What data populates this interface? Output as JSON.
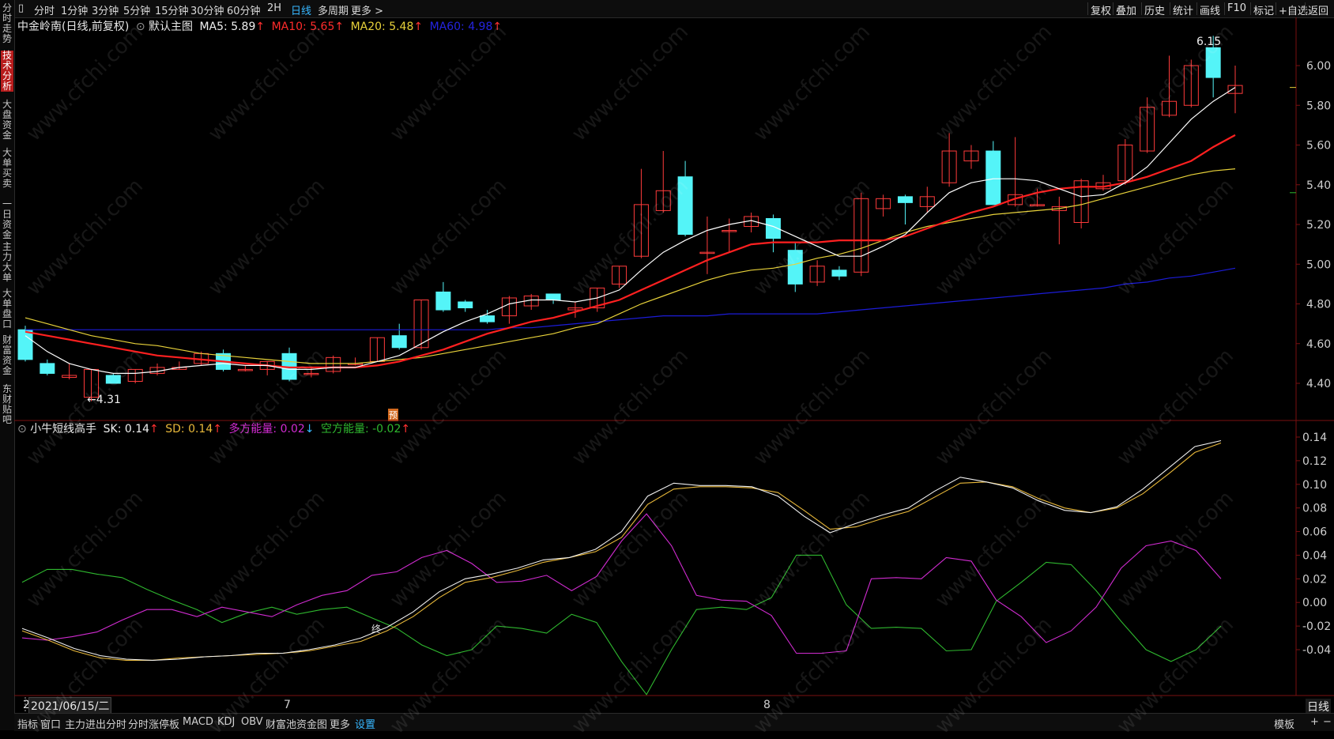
{
  "toolbar": {
    "left_items": [
      {
        "label": "分时",
        "active": false
      },
      {
        "label": "1分钟",
        "active": false
      },
      {
        "label": "3分钟",
        "active": false
      },
      {
        "label": "5分钟",
        "active": false
      },
      {
        "label": "15分钟",
        "active": false
      },
      {
        "label": "30分钟",
        "active": false
      },
      {
        "label": "60分钟",
        "active": false
      },
      {
        "label": "2H",
        "active": false
      },
      {
        "label": "日线",
        "active": true
      },
      {
        "label": "多周期",
        "active": false
      },
      {
        "label": "更多 >",
        "active": false
      }
    ],
    "right_items": [
      "复权",
      "叠加",
      "历史",
      "统计",
      "画线",
      "F10",
      "标记",
      "+自选",
      "返回"
    ]
  },
  "sidebar": {
    "items": [
      {
        "label": "分时走势",
        "active": false
      },
      {
        "label": "技术分析",
        "active": true
      },
      {
        "label": "大盘资金",
        "active": false
      },
      {
        "label": "大单买卖",
        "active": false
      },
      {
        "label": "一日资金",
        "active": false
      },
      {
        "label": "主力大单",
        "active": false
      },
      {
        "label": "大单盘口",
        "active": false
      },
      {
        "label": "财富资金",
        "active": false
      },
      {
        "label": "东财贴吧",
        "active": false
      }
    ]
  },
  "main_legend": {
    "stock": "中金岭南(日线,前复权)",
    "mode": "默认主图",
    "ma5": "MA5: 5.89",
    "ma10": "MA10: 5.65",
    "ma20": "MA20: 5.48",
    "ma60": "MA60: 4.98",
    "arrow_up": "↑"
  },
  "sub_legend": {
    "name": "小牛短线高手",
    "sk": "SK: 0.14",
    "sd": "SD: 0.14",
    "duo": "多方能量: 0.02",
    "kong": "空方能量: -0.02",
    "arrow_up": "↑",
    "arrow_down": "↓"
  },
  "annotations": {
    "high": "6.15",
    "low": "←4.31",
    "buy_tag": "预",
    "label_end": "终"
  },
  "x_axis": {
    "date": "2021/06/15/二",
    "lead": "2",
    "month7": "7",
    "month8": "8",
    "period": "日线"
  },
  "bottombar": {
    "items": [
      {
        "label": "指标",
        "active": false
      },
      {
        "label": "窗口",
        "active": false
      },
      {
        "label": "主力进出分时",
        "active": false
      },
      {
        "label": "分时涨停板",
        "active": false
      },
      {
        "label": "MACD",
        "active": false
      },
      {
        "label": "KDJ",
        "active": false
      },
      {
        "label": "OBV",
        "active": false
      },
      {
        "label": "财富池资金图",
        "active": false
      },
      {
        "label": "更多",
        "active": false
      },
      {
        "label": "设置",
        "active": true
      }
    ],
    "right": [
      "模板",
      "+",
      "−"
    ]
  },
  "watermark": "www.cfchi.com",
  "colors": {
    "up": "#ff3b3b",
    "down": "#54f4f8",
    "ma5": "#ffffff",
    "ma10": "#ff2020",
    "ma20": "#e8d23a",
    "ma60": "#1c1cd8",
    "sk": "#f0f0f0",
    "sd": "#e8b83a",
    "duo": "#d02bd0",
    "kong": "#2fb82f"
  },
  "chart_data": [
    {
      "type": "candlestick",
      "title": "中金岭南(日线,前复权)",
      "yticks": [
        "6.00",
        "5.80",
        "5.60",
        "5.40",
        "5.20",
        "5.00",
        "4.80",
        "4.60",
        "4.40"
      ],
      "ylim": [
        4.29,
        6.22
      ],
      "candles": [
        {
          "o": 4.67,
          "h": 4.69,
          "l": 4.51,
          "c": 4.52
        },
        {
          "o": 4.5,
          "h": 4.52,
          "l": 4.44,
          "c": 4.45
        },
        {
          "o": 4.43,
          "h": 4.5,
          "l": 4.42,
          "c": 4.44
        },
        {
          "o": 4.33,
          "h": 4.47,
          "l": 4.31,
          "c": 4.47
        },
        {
          "o": 4.44,
          "h": 4.45,
          "l": 4.4,
          "c": 4.4
        },
        {
          "o": 4.41,
          "h": 4.47,
          "l": 4.4,
          "c": 4.47
        },
        {
          "o": 4.45,
          "h": 4.5,
          "l": 4.44,
          "c": 4.48
        },
        {
          "o": 4.47,
          "h": 4.51,
          "l": 4.47,
          "c": 4.48
        },
        {
          "o": 4.5,
          "h": 4.56,
          "l": 4.49,
          "c": 4.55
        },
        {
          "o": 4.55,
          "h": 4.57,
          "l": 4.46,
          "c": 4.47
        },
        {
          "o": 4.47,
          "h": 4.49,
          "l": 4.46,
          "c": 4.47
        },
        {
          "o": 4.47,
          "h": 4.51,
          "l": 4.44,
          "c": 4.51
        },
        {
          "o": 4.55,
          "h": 4.58,
          "l": 4.41,
          "c": 4.42
        },
        {
          "o": 4.45,
          "h": 4.48,
          "l": 4.43,
          "c": 4.45
        },
        {
          "o": 4.46,
          "h": 4.54,
          "l": 4.45,
          "c": 4.53
        },
        {
          "o": 4.5,
          "h": 4.53,
          "l": 4.49,
          "c": 4.5
        },
        {
          "o": 4.51,
          "h": 4.63,
          "l": 4.51,
          "c": 4.63
        },
        {
          "o": 4.64,
          "h": 4.7,
          "l": 4.57,
          "c": 4.58
        },
        {
          "o": 4.58,
          "h": 4.82,
          "l": 4.57,
          "c": 4.82
        },
        {
          "o": 4.86,
          "h": 4.91,
          "l": 4.76,
          "c": 4.77
        },
        {
          "o": 4.81,
          "h": 4.82,
          "l": 4.76,
          "c": 4.78
        },
        {
          "o": 4.74,
          "h": 4.77,
          "l": 4.7,
          "c": 4.71
        },
        {
          "o": 4.74,
          "h": 4.84,
          "l": 4.7,
          "c": 4.83
        },
        {
          "o": 4.79,
          "h": 4.85,
          "l": 4.77,
          "c": 4.84
        },
        {
          "o": 4.85,
          "h": 4.85,
          "l": 4.8,
          "c": 4.82
        },
        {
          "o": 4.77,
          "h": 4.81,
          "l": 4.73,
          "c": 4.78
        },
        {
          "o": 4.78,
          "h": 4.88,
          "l": 4.76,
          "c": 4.88
        },
        {
          "o": 4.9,
          "h": 4.99,
          "l": 4.88,
          "c": 4.99
        },
        {
          "o": 5.04,
          "h": 5.48,
          "l": 5.03,
          "c": 5.3
        },
        {
          "o": 5.27,
          "h": 5.57,
          "l": 5.26,
          "c": 5.37
        },
        {
          "o": 5.44,
          "h": 5.52,
          "l": 5.14,
          "c": 5.15
        },
        {
          "o": 5.06,
          "h": 5.24,
          "l": 4.95,
          "c": 5.06
        },
        {
          "o": 5.17,
          "h": 5.23,
          "l": 5.06,
          "c": 5.17
        },
        {
          "o": 5.19,
          "h": 5.26,
          "l": 5.16,
          "c": 5.24
        },
        {
          "o": 5.23,
          "h": 5.25,
          "l": 5.06,
          "c": 5.13
        },
        {
          "o": 5.07,
          "h": 5.11,
          "l": 4.86,
          "c": 4.9
        },
        {
          "o": 4.91,
          "h": 5.02,
          "l": 4.89,
          "c": 4.99
        },
        {
          "o": 4.97,
          "h": 4.99,
          "l": 4.92,
          "c": 4.94
        },
        {
          "o": 4.96,
          "h": 5.36,
          "l": 4.94,
          "c": 5.33
        },
        {
          "o": 5.28,
          "h": 5.35,
          "l": 5.24,
          "c": 5.33
        },
        {
          "o": 5.34,
          "h": 5.35,
          "l": 5.2,
          "c": 5.31
        },
        {
          "o": 5.29,
          "h": 5.39,
          "l": 5.26,
          "c": 5.34
        },
        {
          "o": 5.41,
          "h": 5.66,
          "l": 5.39,
          "c": 5.57
        },
        {
          "o": 5.52,
          "h": 5.6,
          "l": 5.48,
          "c": 5.57
        },
        {
          "o": 5.57,
          "h": 5.62,
          "l": 5.3,
          "c": 5.3
        },
        {
          "o": 5.3,
          "h": 5.64,
          "l": 5.29,
          "c": 5.35
        },
        {
          "o": 5.3,
          "h": 5.38,
          "l": 5.29,
          "c": 5.3
        },
        {
          "o": 5.27,
          "h": 5.34,
          "l": 5.1,
          "c": 5.29
        },
        {
          "o": 5.21,
          "h": 5.43,
          "l": 5.18,
          "c": 5.42
        },
        {
          "o": 5.38,
          "h": 5.45,
          "l": 5.37,
          "c": 5.41
        },
        {
          "o": 5.42,
          "h": 5.63,
          "l": 5.4,
          "c": 5.6
        },
        {
          "o": 5.57,
          "h": 5.84,
          "l": 5.56,
          "c": 5.79
        },
        {
          "o": 5.75,
          "h": 6.05,
          "l": 5.74,
          "c": 5.82
        },
        {
          "o": 5.8,
          "h": 6.03,
          "l": 5.79,
          "c": 6.0
        },
        {
          "o": 6.09,
          "h": 6.15,
          "l": 5.84,
          "c": 5.94
        },
        {
          "o": 5.86,
          "h": 6.0,
          "l": 5.76,
          "c": 5.9
        }
      ],
      "ma5": [
        4.64,
        4.56,
        4.5,
        4.47,
        4.45,
        4.45,
        4.46,
        4.48,
        4.49,
        4.5,
        4.49,
        4.49,
        4.47,
        4.47,
        4.48,
        4.48,
        4.51,
        4.54,
        4.6,
        4.66,
        4.71,
        4.75,
        4.8,
        4.82,
        4.82,
        4.81,
        4.83,
        4.87,
        4.97,
        5.06,
        5.12,
        5.17,
        5.2,
        5.22,
        5.19,
        5.14,
        5.09,
        5.04,
        5.04,
        5.09,
        5.15,
        5.26,
        5.36,
        5.41,
        5.43,
        5.43,
        5.42,
        5.38,
        5.34,
        5.35,
        5.41,
        5.49,
        5.61,
        5.73,
        5.82,
        5.89
      ],
      "ma10": [
        4.66,
        4.64,
        4.62,
        4.6,
        4.58,
        4.56,
        4.54,
        4.53,
        4.52,
        4.51,
        4.5,
        4.49,
        4.48,
        4.48,
        4.48,
        4.48,
        4.49,
        4.51,
        4.54,
        4.57,
        4.61,
        4.65,
        4.68,
        4.71,
        4.73,
        4.76,
        4.79,
        4.82,
        4.87,
        4.92,
        4.97,
        5.02,
        5.06,
        5.1,
        5.11,
        5.11,
        5.11,
        5.12,
        5.12,
        5.12,
        5.14,
        5.18,
        5.22,
        5.26,
        5.29,
        5.33,
        5.36,
        5.38,
        5.39,
        5.39,
        5.41,
        5.44,
        5.48,
        5.52,
        5.59,
        5.65
      ],
      "ma20": [
        4.73,
        4.7,
        4.67,
        4.64,
        4.62,
        4.6,
        4.59,
        4.57,
        4.55,
        4.54,
        4.53,
        4.52,
        4.51,
        4.5,
        4.5,
        4.5,
        4.51,
        4.52,
        4.53,
        4.55,
        4.57,
        4.59,
        4.61,
        4.63,
        4.65,
        4.68,
        4.7,
        4.75,
        4.8,
        4.84,
        4.88,
        4.92,
        4.95,
        4.97,
        4.98,
        5.0,
        5.03,
        5.05,
        5.08,
        5.12,
        5.16,
        5.19,
        5.21,
        5.23,
        5.25,
        5.26,
        5.27,
        5.28,
        5.3,
        5.33,
        5.36,
        5.39,
        5.42,
        5.45,
        5.47,
        5.48
      ],
      "ma60": [
        4.67,
        4.67,
        4.67,
        4.67,
        4.67,
        4.67,
        4.67,
        4.67,
        4.67,
        4.67,
        4.67,
        4.67,
        4.67,
        4.67,
        4.67,
        4.67,
        4.67,
        4.67,
        4.67,
        4.67,
        4.67,
        4.67,
        4.68,
        4.68,
        4.69,
        4.7,
        4.71,
        4.72,
        4.73,
        4.74,
        4.74,
        4.74,
        4.75,
        4.75,
        4.75,
        4.75,
        4.75,
        4.76,
        4.77,
        4.78,
        4.79,
        4.8,
        4.81,
        4.82,
        4.83,
        4.84,
        4.85,
        4.86,
        4.87,
        4.88,
        4.9,
        4.91,
        4.93,
        4.94,
        4.96,
        4.98
      ]
    },
    {
      "type": "line",
      "title": "小牛短线高手",
      "yticks": [
        "0.14",
        "0.12",
        "0.10",
        "0.08",
        "0.06",
        "0.04",
        "0.02",
        "0.00",
        "-0.02",
        "-0.04"
      ],
      "ylim": [
        -0.08,
        0.15
      ],
      "series": [
        {
          "name": "SK",
          "values": [
            -0.022,
            -0.03,
            -0.039,
            -0.045,
            -0.048,
            -0.049,
            -0.048,
            -0.046,
            -0.045,
            -0.043,
            -0.043,
            -0.04,
            -0.036,
            -0.03,
            -0.021,
            -0.008,
            0.009,
            0.02,
            0.024,
            0.029,
            0.036,
            0.038,
            0.045,
            0.06,
            0.09,
            0.101,
            0.099,
            0.099,
            0.098,
            0.09,
            0.073,
            0.059,
            0.067,
            0.074,
            0.08,
            0.094,
            0.106,
            0.102,
            0.097,
            0.086,
            0.078,
            0.076,
            0.081,
            0.096,
            0.114,
            0.132,
            0.137
          ]
        },
        {
          "name": "SD",
          "values": [
            -0.024,
            -0.032,
            -0.041,
            -0.047,
            -0.049,
            -0.049,
            -0.047,
            -0.046,
            -0.045,
            -0.044,
            -0.043,
            -0.041,
            -0.037,
            -0.033,
            -0.024,
            -0.012,
            0.004,
            0.017,
            0.021,
            0.027,
            0.034,
            0.038,
            0.043,
            0.055,
            0.083,
            0.096,
            0.098,
            0.098,
            0.097,
            0.093,
            0.078,
            0.062,
            0.064,
            0.071,
            0.077,
            0.089,
            0.101,
            0.102,
            0.098,
            0.088,
            0.08,
            0.076,
            0.08,
            0.092,
            0.109,
            0.127,
            0.135
          ]
        },
        {
          "name": "多方能量",
          "values": [
            -0.03,
            -0.032,
            -0.029,
            -0.025,
            -0.015,
            -0.006,
            -0.006,
            -0.012,
            -0.004,
            -0.008,
            -0.012,
            -0.002,
            0.006,
            0.01,
            0.023,
            0.026,
            0.038,
            0.044,
            0.033,
            0.017,
            0.018,
            0.023,
            0.01,
            0.022,
            0.052,
            0.075,
            0.048,
            0.006,
            0.002,
            0.001,
            -0.011,
            -0.043,
            -0.043,
            -0.041,
            0.02,
            0.021,
            0.02,
            0.038,
            0.035,
            0.002,
            -0.012,
            -0.034,
            -0.024,
            -0.004,
            0.029,
            0.048,
            0.052,
            0.044,
            0.02
          ]
        },
        {
          "name": "空方能量",
          "values": [
            0.017,
            0.028,
            0.028,
            0.024,
            0.021,
            0.011,
            0.002,
            -0.006,
            -0.017,
            -0.009,
            -0.004,
            -0.01,
            -0.006,
            -0.004,
            -0.013,
            -0.022,
            -0.036,
            -0.045,
            -0.04,
            -0.02,
            -0.022,
            -0.026,
            -0.01,
            -0.017,
            -0.05,
            -0.078,
            -0.04,
            -0.006,
            -0.004,
            -0.006,
            0.004,
            0.04,
            0.04,
            -0.002,
            -0.022,
            -0.021,
            -0.022,
            -0.041,
            -0.04,
            0.001,
            0.017,
            0.034,
            0.032,
            0.01,
            -0.016,
            -0.04,
            -0.05,
            -0.04,
            -0.02
          ]
        }
      ]
    }
  ]
}
